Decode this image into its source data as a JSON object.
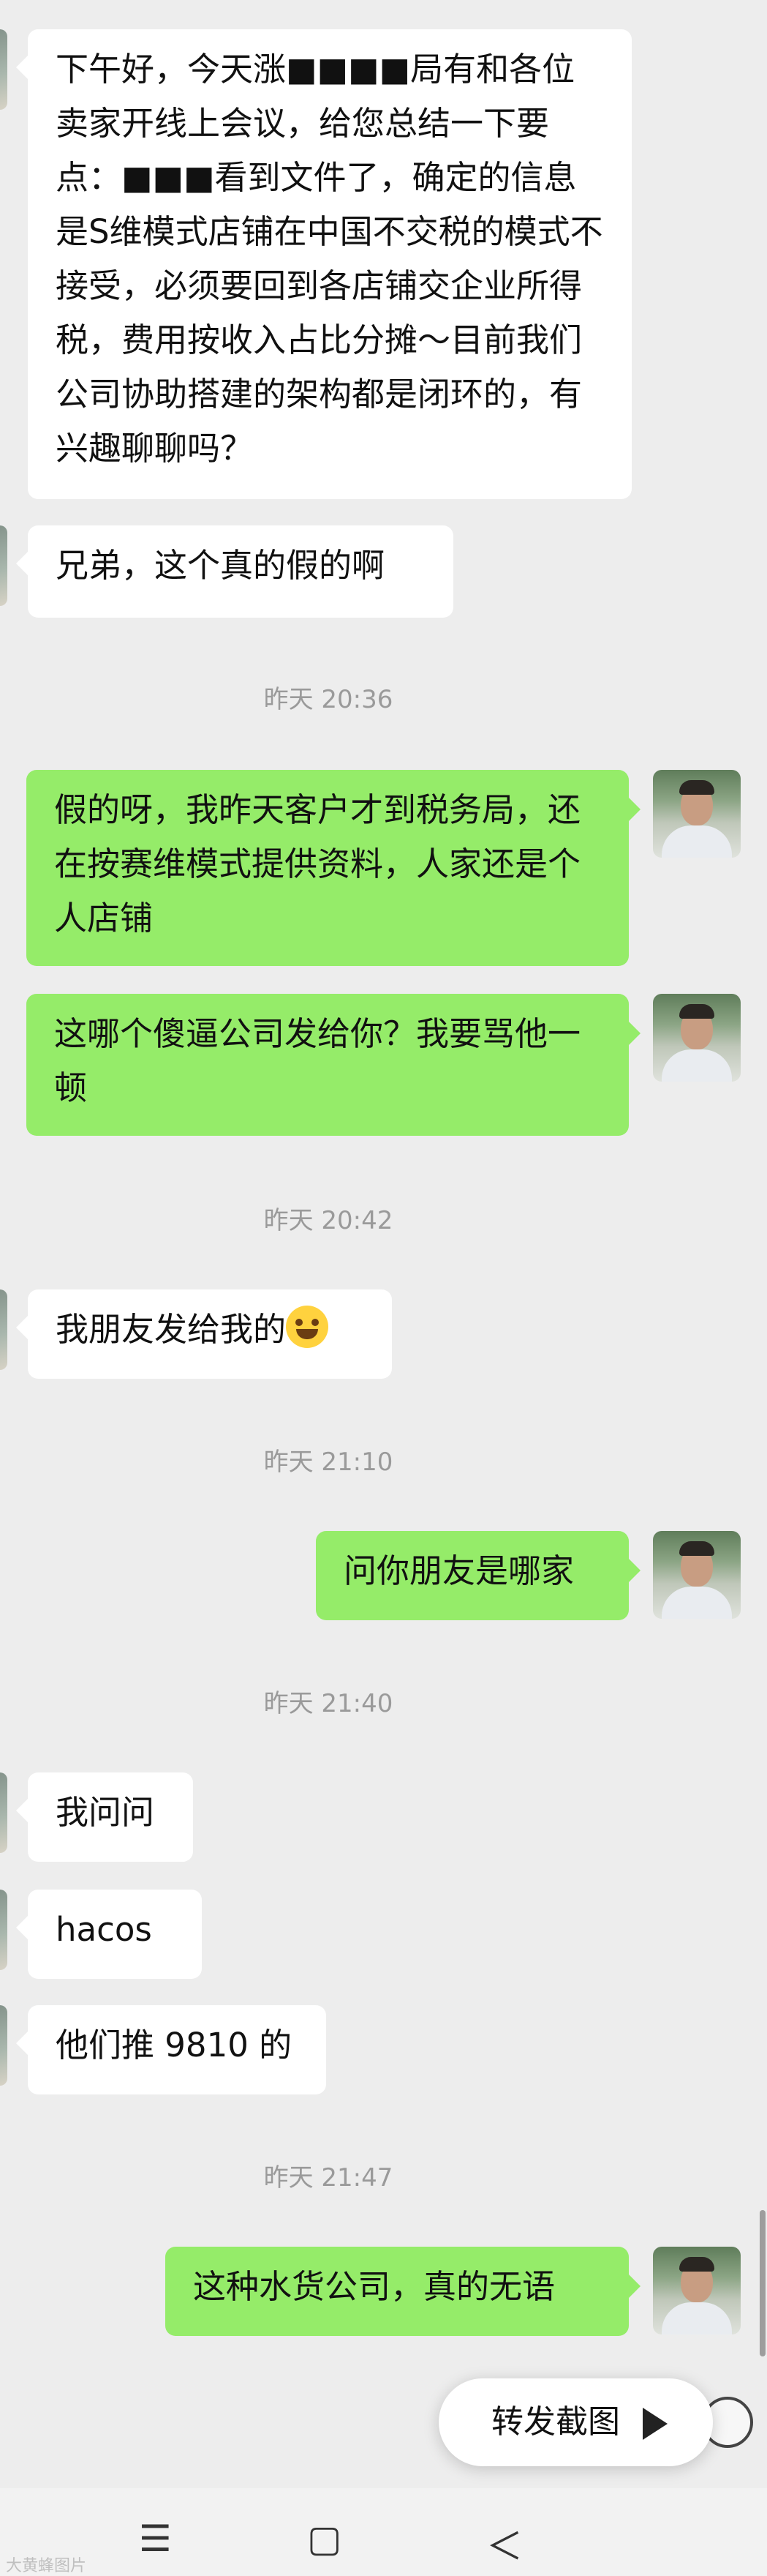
{
  "messages": [
    {
      "side": "in",
      "text": "下午好，今天涨■■■■局有和各位卖家开线上会议，给您总结一下要点：■■■看到文件了，确定的信息是S维模式店铺在中国不交税的模式不接受，必须要回到各店铺交企业所得税，费用按收入占比分摊～目前我们公司协助搭建的架构都是闭环的，有兴趣聊聊吗？"
    },
    {
      "side": "in",
      "text": "兄弟，这个真的假的啊"
    },
    {
      "side": "out",
      "text": "假的呀，我昨天客户才到税务局，还在按赛维模式提供资料，人家还是个人店铺"
    },
    {
      "side": "out",
      "text": "这哪个傻逼公司发给你？我要骂他一顿"
    },
    {
      "side": "in",
      "text": "我朋友发给我的"
    },
    {
      "side": "out",
      "text": "问你朋友是哪家"
    },
    {
      "side": "in",
      "text": "我问问"
    },
    {
      "side": "in",
      "text": "hacos"
    },
    {
      "side": "in",
      "text": "他们推 9810 的"
    },
    {
      "side": "out",
      "text": "这种水货公司，真的无语"
    }
  ],
  "timestamps": [
    "昨天 20:36",
    "昨天 20:42",
    "昨天 21:10",
    "昨天 21:40",
    "昨天 21:47"
  ],
  "forward_button": {
    "label": "转发截图",
    "icon": "share-arrow-icon"
  },
  "nav": {
    "menu": "☰",
    "home": "▢",
    "back": "＜"
  },
  "watermark": "大黄蜂图片"
}
